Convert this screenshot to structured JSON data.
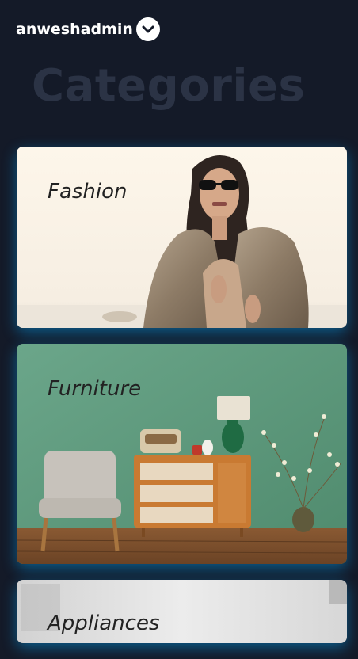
{
  "header": {
    "username": "anweshadmin",
    "dropdown_icon": "chevron-down-icon"
  },
  "page": {
    "title": "Categories"
  },
  "categories": [
    {
      "label": "Fashion",
      "image": "fashion-model-fur-coat"
    },
    {
      "label": "Furniture",
      "image": "armchair-dresser-green-wall"
    },
    {
      "label": "Appliances",
      "image": "kitchen-appliances"
    }
  ],
  "colors": {
    "background": "#141a28",
    "title": "#2b3345",
    "glow": "#00aaff"
  }
}
